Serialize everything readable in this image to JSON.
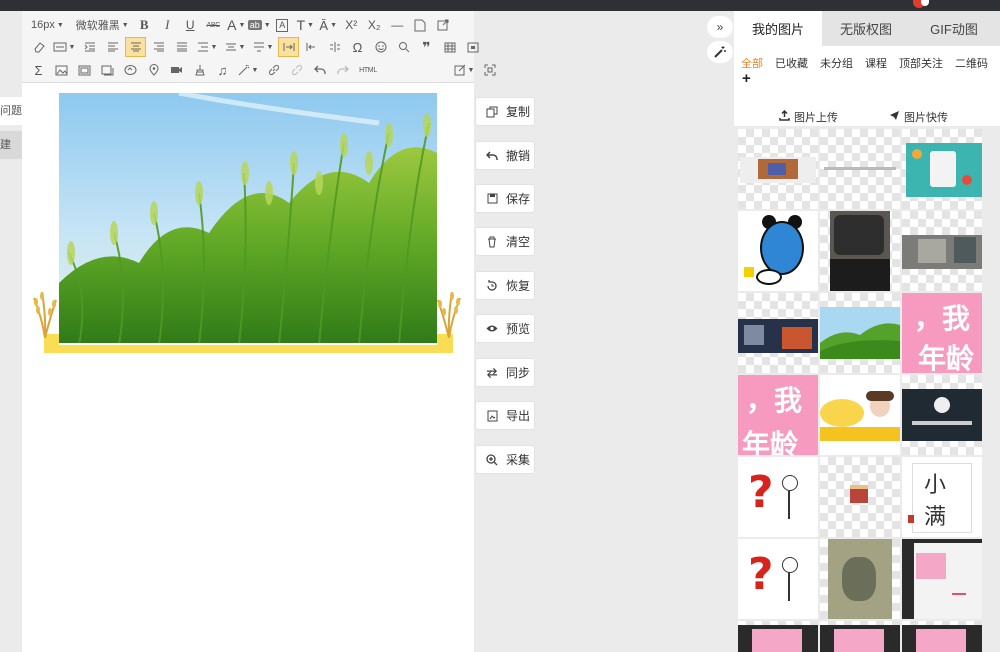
{
  "toolbar": {
    "font_size": "16px",
    "font_family": "微软雅黑",
    "bold": "B",
    "italic": "I",
    "underline": "U",
    "strike": "ABC",
    "font_color": "A",
    "highlight": "ab",
    "superscript": "X²",
    "subscript": "X₂",
    "omega": "Ω",
    "quote": "❞",
    "html": "HTML"
  },
  "left_tabs": {
    "tab1": "问题",
    "tab2": "建"
  },
  "actions": [
    {
      "label": "复制",
      "icon": "copy-icon"
    },
    {
      "label": "撤销",
      "icon": "undo-icon"
    },
    {
      "label": "保存",
      "icon": "save-icon"
    },
    {
      "label": "清空",
      "icon": "trash-icon"
    },
    {
      "label": "恢复",
      "icon": "restore-icon"
    },
    {
      "label": "预览",
      "icon": "eye-icon"
    },
    {
      "label": "同步",
      "icon": "sync-icon"
    },
    {
      "label": "导出",
      "icon": "export-icon"
    },
    {
      "label": "采集",
      "icon": "collect-icon"
    }
  ],
  "panel": {
    "tabs": [
      "我的图片",
      "无版权图",
      "GIF动图"
    ],
    "active_tab": "我的图片",
    "categories": [
      "全部",
      "已收藏",
      "未分组",
      "课程",
      "顶部关注",
      "二维码"
    ],
    "active_category": "全部",
    "add": "+",
    "upload_label": "图片上传",
    "quick_label": "图片快传"
  },
  "thumb_text": {
    "wo": "，我",
    "nianling": "年龄",
    "xiao": "小",
    "man": "满"
  },
  "colors": {
    "accent_orange": "#e0852b",
    "active_button": "#fbe1a0",
    "yellow_bar": "#f8dd55",
    "pink_thumb": "#f79ac0",
    "topbar": "#2d3034"
  }
}
